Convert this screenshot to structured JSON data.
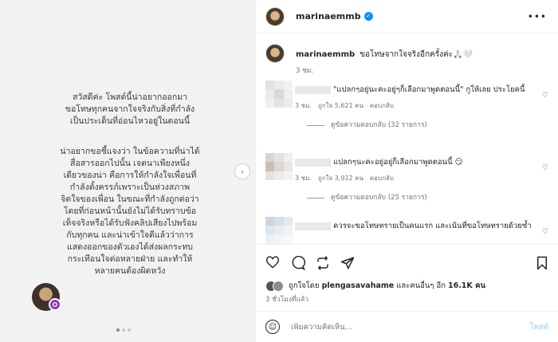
{
  "post_image": {
    "paragraphs": [
      "สวัสดีค่ะ โพสต์นี้น่าอยากออกมา\nขอโทษทุกคนจากใจจริงกับสิ่งที่กำลัง\nเป็นประเด็นที่อ่อนไหวอยู่ในตอนนี้",
      "น่าอยากขอชี้แจงว่า ในข้อความที่น่าได้\nสื่อสารออกไปนั้น เจตนาเพียงหนึ่ง\nเดียวของน่า คือการให้กำลังใจเพื่อนที่\nกำลังตั้งครรภ์เพราะเป็นห่วงสภาพ\nจิตใจของเพื่อน ในขณะที่กำลังถูกต่อว่า\nโดยที่ก่อนหน้านั้นยังไม่ได้รับทราบข้อ\nเท็จจริงหรือได้รับฟังคลิปเสียงไปพร้อม\nกับทุกคน และน่าเข้าใจดีแล้วว่าการ\nแสดงออกของตัวเองได้ส่งผลกระทบ\nกระเทือนใจต่อหลายฝ่าย และทำให้\nหลายคนต้องผิดหวัง"
    ],
    "next_icon": "chevron-right-icon"
  },
  "header": {
    "username": "marinaemmb",
    "verified_icon": "verified-badge-icon",
    "more_icon": "more-options-icon",
    "more_glyph": "•••"
  },
  "caption": {
    "username": "marinaemmb",
    "text": "ขอโทษจากใจจริงอีกครั้งค่ะ🙏🏻🤍",
    "time": "3 ชม."
  },
  "comments": [
    {
      "text": "\"แปลกๆอยู่นะคะอยู่ๆก็เลือกมาพูดตอนนี้\" กูให้เลย ประโยคนี้",
      "time": "3 ชม.",
      "likes": "ถูกใจ 5,621 คน",
      "reply": "ตอบกลับ",
      "view_replies": "ดูข้อความตอบกลับ (32 รายการ)"
    },
    {
      "text": "แปลกๆนะคะอยู่อยู่ก็เลือกมาพูดตอนนี้ 😏",
      "time": "3 ชม.",
      "likes": "ถูกใจ 3,912 คน",
      "reply": "ตอบกลับ",
      "view_replies": "ดูข้อความตอบกลับ (25 รายการ)"
    },
    {
      "text": "ควรจะขอโทษทรายเป็นคนแรก และเน้นที่ขอโทษทรายด้วยซ้ำ"
    }
  ],
  "actions": {
    "like_icon": "heart-icon",
    "comment_icon": "comment-icon",
    "repost_icon": "repost-icon",
    "share_icon": "share-icon",
    "save_icon": "bookmark-icon"
  },
  "likes_line": {
    "prefix": "ถูกใจโดย ",
    "user": "plengasavahame",
    "middle": " และคนอื่นๆ อีก ",
    "count": "16.1K",
    "suffix": " คน"
  },
  "post_time": "3 ชั่วโมงที่แล้ว",
  "comment_box": {
    "placeholder": "เพิ่มความคิดเห็น...",
    "post_label": "โพสต์"
  },
  "colors": {
    "verified": "#0095f6",
    "post_button": "#b2dffc"
  }
}
